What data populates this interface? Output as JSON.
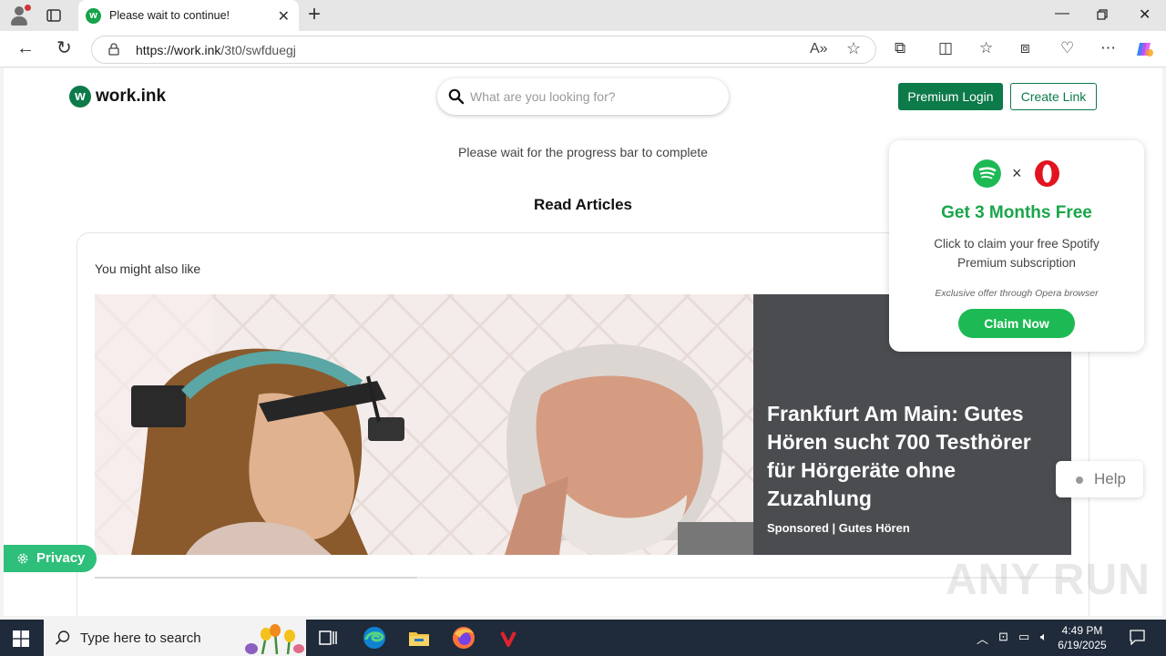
{
  "browser": {
    "tab_title": "Please wait to continue!",
    "tab_favicon_letter": "w",
    "url_host": "https://work.ink",
    "url_path": "/3t0/swfduegj"
  },
  "site": {
    "logo_mark": "w",
    "logo_text": "work.ink",
    "search_placeholder": "What are you looking for?",
    "premium_login": "Premium Login",
    "create_link": "Create Link",
    "wait_message": "Please wait for the progress bar to complete",
    "section_title": "Read Articles",
    "also_like": "You might also like",
    "progress": 0.33
  },
  "ad": {
    "headline": "Frankfurt Am Main: Gutes Hören sucht 700 Testhörer für Hörgeräte ohne Zuzahlung",
    "sponsor": "Sponsored | Gutes Hören"
  },
  "promo": {
    "times": "×",
    "headline": "Get 3 Months Free",
    "description": "Click to claim your free Spotify Premium subscription",
    "exclusive": "Exclusive offer through Opera browser",
    "claim_button": "Claim Now"
  },
  "help": {
    "label": "Help"
  },
  "privacy": {
    "label": "Privacy"
  },
  "watermark": "ANY RUN",
  "taskbar": {
    "search_placeholder": "Type here to search",
    "time": "4:49 PM",
    "date": "6/19/2025"
  },
  "colors": {
    "brand_green": "#0d7a4a",
    "spotify_green": "#1db954",
    "privacy_green": "#2ebf7a",
    "ad_panel": "#4a4c50"
  }
}
